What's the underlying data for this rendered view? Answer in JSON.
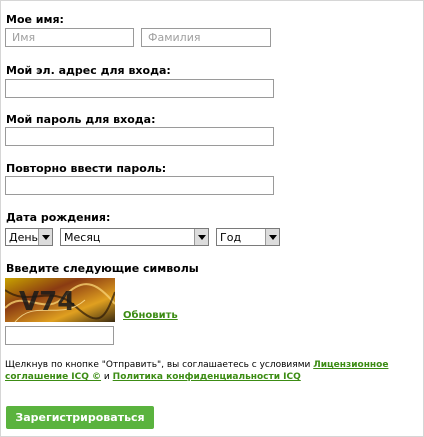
{
  "form": {
    "name_label": "Мое имя:",
    "first_name_placeholder": "Имя",
    "last_name_placeholder": "Фамилия",
    "email_label": "Мой эл. адрес для входа:",
    "password_label": "Мой пароль для входа:",
    "repeat_password_label": "Повторно ввести пароль:",
    "birthdate_label": "Дата рождения:",
    "day_select": "День",
    "month_select": "Месяц",
    "year_select": "Год",
    "captcha_label": "Введите следующие символы",
    "captcha_text": "V74",
    "refresh_link": "Обновить",
    "terms_text": "Щелкнув по кнопке \"Отправить\", вы соглашаетесь с условиями",
    "license_link": "Лицензионное соглашение ICQ ©",
    "terms_and": "и",
    "privacy_link": "Политика конфиденциальности ICQ",
    "submit_button": "Зарегистрироваться"
  },
  "colors": {
    "accent_green": "#5ab33e",
    "link_green": "#3c8c14"
  }
}
